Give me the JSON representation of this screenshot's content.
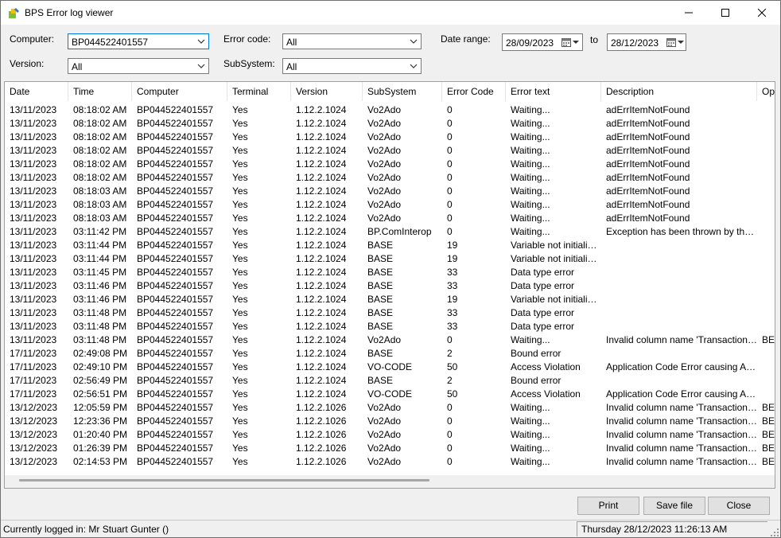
{
  "window": {
    "title": "BPS Error log viewer"
  },
  "filters": {
    "computer_label": "Computer:",
    "computer_value": "BP044522401557",
    "version_label": "Version:",
    "version_value": "All",
    "error_code_label": "Error code:",
    "error_code_value": "All",
    "subsystem_label": "SubSystem:",
    "subsystem_value": "All",
    "date_range_label": "Date range:",
    "date_from": "28/09/2023",
    "to_label": "to",
    "date_to": "28/12/2023"
  },
  "grid": {
    "columns": [
      "Date",
      "Time",
      "Computer",
      "Terminal",
      "Version",
      "SubSystem",
      "Error Code",
      "Error text",
      "Description",
      "Op"
    ],
    "rows": [
      [
        "13/11/2023",
        "08:18:02 AM",
        "BP044522401557",
        "Yes",
        "1.12.2.1024",
        "Vo2Ado",
        "0",
        "Waiting...",
        "adErrItemNotFound",
        ""
      ],
      [
        "13/11/2023",
        "08:18:02 AM",
        "BP044522401557",
        "Yes",
        "1.12.2.1024",
        "Vo2Ado",
        "0",
        "Waiting...",
        "adErrItemNotFound",
        ""
      ],
      [
        "13/11/2023",
        "08:18:02 AM",
        "BP044522401557",
        "Yes",
        "1.12.2.1024",
        "Vo2Ado",
        "0",
        "Waiting...",
        "adErrItemNotFound",
        ""
      ],
      [
        "13/11/2023",
        "08:18:02 AM",
        "BP044522401557",
        "Yes",
        "1.12.2.1024",
        "Vo2Ado",
        "0",
        "Waiting...",
        "adErrItemNotFound",
        ""
      ],
      [
        "13/11/2023",
        "08:18:02 AM",
        "BP044522401557",
        "Yes",
        "1.12.2.1024",
        "Vo2Ado",
        "0",
        "Waiting...",
        "adErrItemNotFound",
        ""
      ],
      [
        "13/11/2023",
        "08:18:02 AM",
        "BP044522401557",
        "Yes",
        "1.12.2.1024",
        "Vo2Ado",
        "0",
        "Waiting...",
        "adErrItemNotFound",
        ""
      ],
      [
        "13/11/2023",
        "08:18:03 AM",
        "BP044522401557",
        "Yes",
        "1.12.2.1024",
        "Vo2Ado",
        "0",
        "Waiting...",
        "adErrItemNotFound",
        ""
      ],
      [
        "13/11/2023",
        "08:18:03 AM",
        "BP044522401557",
        "Yes",
        "1.12.2.1024",
        "Vo2Ado",
        "0",
        "Waiting...",
        "adErrItemNotFound",
        ""
      ],
      [
        "13/11/2023",
        "08:18:03 AM",
        "BP044522401557",
        "Yes",
        "1.12.2.1024",
        "Vo2Ado",
        "0",
        "Waiting...",
        "adErrItemNotFound",
        ""
      ],
      [
        "13/11/2023",
        "03:11:42 PM",
        "BP044522401557",
        "Yes",
        "1.12.2.1024",
        "BP.ComInterop",
        "0",
        "Waiting...",
        "Exception has been thrown by the tar...",
        ""
      ],
      [
        "13/11/2023",
        "03:11:44 PM",
        "BP044522401557",
        "Yes",
        "1.12.2.1024",
        "BASE",
        "19",
        "Variable not initialized",
        "",
        ""
      ],
      [
        "13/11/2023",
        "03:11:44 PM",
        "BP044522401557",
        "Yes",
        "1.12.2.1024",
        "BASE",
        "19",
        "Variable not initialized",
        "",
        ""
      ],
      [
        "13/11/2023",
        "03:11:45 PM",
        "BP044522401557",
        "Yes",
        "1.12.2.1024",
        "BASE",
        "33",
        "Data type error",
        "",
        ""
      ],
      [
        "13/11/2023",
        "03:11:46 PM",
        "BP044522401557",
        "Yes",
        "1.12.2.1024",
        "BASE",
        "33",
        "Data type error",
        "",
        ""
      ],
      [
        "13/11/2023",
        "03:11:46 PM",
        "BP044522401557",
        "Yes",
        "1.12.2.1024",
        "BASE",
        "19",
        "Variable not initialized",
        "",
        ""
      ],
      [
        "13/11/2023",
        "03:11:48 PM",
        "BP044522401557",
        "Yes",
        "1.12.2.1024",
        "BASE",
        "33",
        "Data type error",
        "",
        ""
      ],
      [
        "13/11/2023",
        "03:11:48 PM",
        "BP044522401557",
        "Yes",
        "1.12.2.1024",
        "BASE",
        "33",
        "Data type error",
        "",
        ""
      ],
      [
        "13/11/2023",
        "03:11:48 PM",
        "BP044522401557",
        "Yes",
        "1.12.2.1024",
        "Vo2Ado",
        "0",
        "Waiting...",
        "Invalid column name 'TransactionType'.",
        "BE"
      ],
      [
        "17/11/2023",
        "02:49:08 PM",
        "BP044522401557",
        "Yes",
        "1.12.2.1024",
        "BASE",
        "2",
        "Bound error",
        "",
        ""
      ],
      [
        "17/11/2023",
        "02:49:10 PM",
        "BP044522401557",
        "Yes",
        "1.12.2.1024",
        "VO-CODE",
        "50",
        "Access Violation",
        "Application Code Error causing Acces...",
        ""
      ],
      [
        "17/11/2023",
        "02:56:49 PM",
        "BP044522401557",
        "Yes",
        "1.12.2.1024",
        "BASE",
        "2",
        "Bound error",
        "",
        ""
      ],
      [
        "17/11/2023",
        "02:56:51 PM",
        "BP044522401557",
        "Yes",
        "1.12.2.1024",
        "VO-CODE",
        "50",
        "Access Violation",
        "Application Code Error causing Acces...",
        ""
      ],
      [
        "13/12/2023",
        "12:05:59 PM",
        "BP044522401557",
        "Yes",
        "1.12.2.1026",
        "Vo2Ado",
        "0",
        "Waiting...",
        "Invalid column name 'TransactionType'.",
        "BE"
      ],
      [
        "13/12/2023",
        "12:23:36 PM",
        "BP044522401557",
        "Yes",
        "1.12.2.1026",
        "Vo2Ado",
        "0",
        "Waiting...",
        "Invalid column name 'TransactionType'.",
        "BE"
      ],
      [
        "13/12/2023",
        "01:20:40 PM",
        "BP044522401557",
        "Yes",
        "1.12.2.1026",
        "Vo2Ado",
        "0",
        "Waiting...",
        "Invalid column name 'TransactionType'.",
        "BE"
      ],
      [
        "13/12/2023",
        "01:26:39 PM",
        "BP044522401557",
        "Yes",
        "1.12.2.1026",
        "Vo2Ado",
        "0",
        "Waiting...",
        "Invalid column name 'TransactionType'.",
        "BE"
      ],
      [
        "13/12/2023",
        "02:14:53 PM",
        "BP044522401557",
        "Yes",
        "1.12.2.1026",
        "Vo2Ado",
        "0",
        "Waiting...",
        "Invalid column name 'TransactionType'.",
        "BE"
      ]
    ]
  },
  "buttons": {
    "print": "Print",
    "save": "Save file",
    "close": "Close"
  },
  "status": {
    "left": "Currently logged in:  Mr Stuart Gunter ()",
    "right": "Thursday 28/12/2023 11:26:13 AM"
  },
  "icons": {
    "app": "app-logo-icon",
    "minimize": "minimize-icon",
    "maximize": "maximize-icon",
    "close": "close-icon",
    "dropdown": "chevron-down-icon",
    "calendar": "calendar-icon",
    "grip": "size-grip-icon"
  },
  "colors": {
    "focus_border": "#0078d7",
    "grid_bg": "#ffffff",
    "window_bg": "#f0f0f0"
  }
}
